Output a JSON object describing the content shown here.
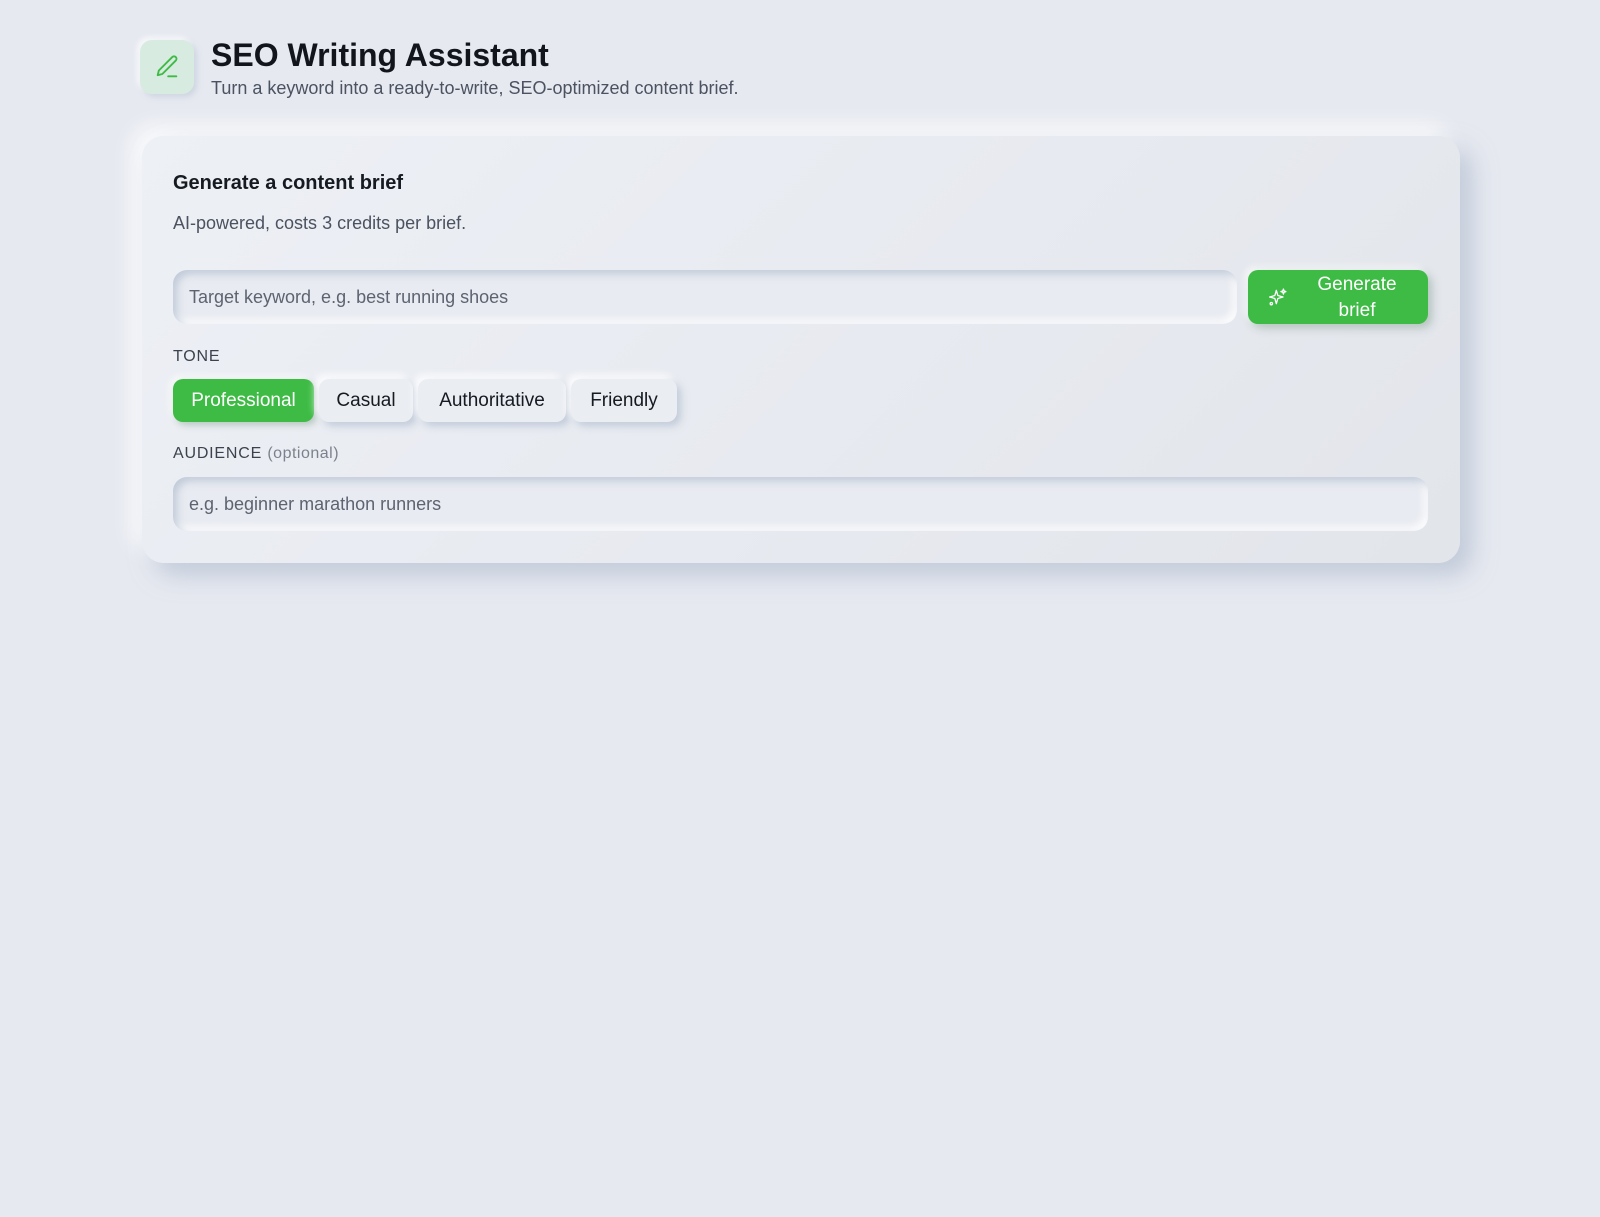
{
  "header": {
    "logo_icon": "pencil-icon",
    "title": "SEO Writing Assistant",
    "subtitle": "Turn a keyword into a ready-to-write, SEO-optimized content brief."
  },
  "brief_form": {
    "title": "Generate a content brief",
    "subtitle": "AI-powered, costs 3 credits per brief.",
    "keyword_input": {
      "value": "",
      "placeholder": "Target keyword, e.g. best running shoes"
    },
    "generate_button": {
      "label": "Generate brief",
      "icon": "sparkles-icon"
    },
    "tone": {
      "label": "TONE",
      "options": [
        "Professional",
        "Casual",
        "Authoritative",
        "Friendly"
      ],
      "selected": "Professional"
    },
    "audience": {
      "label": "AUDIENCE",
      "hint": "(optional)",
      "value": "",
      "placeholder": "e.g. beginner marathon runners"
    }
  },
  "colors": {
    "accent": "#3dbb44",
    "background": "#e6e9f0",
    "logo_tile": "#d8ebe0"
  }
}
